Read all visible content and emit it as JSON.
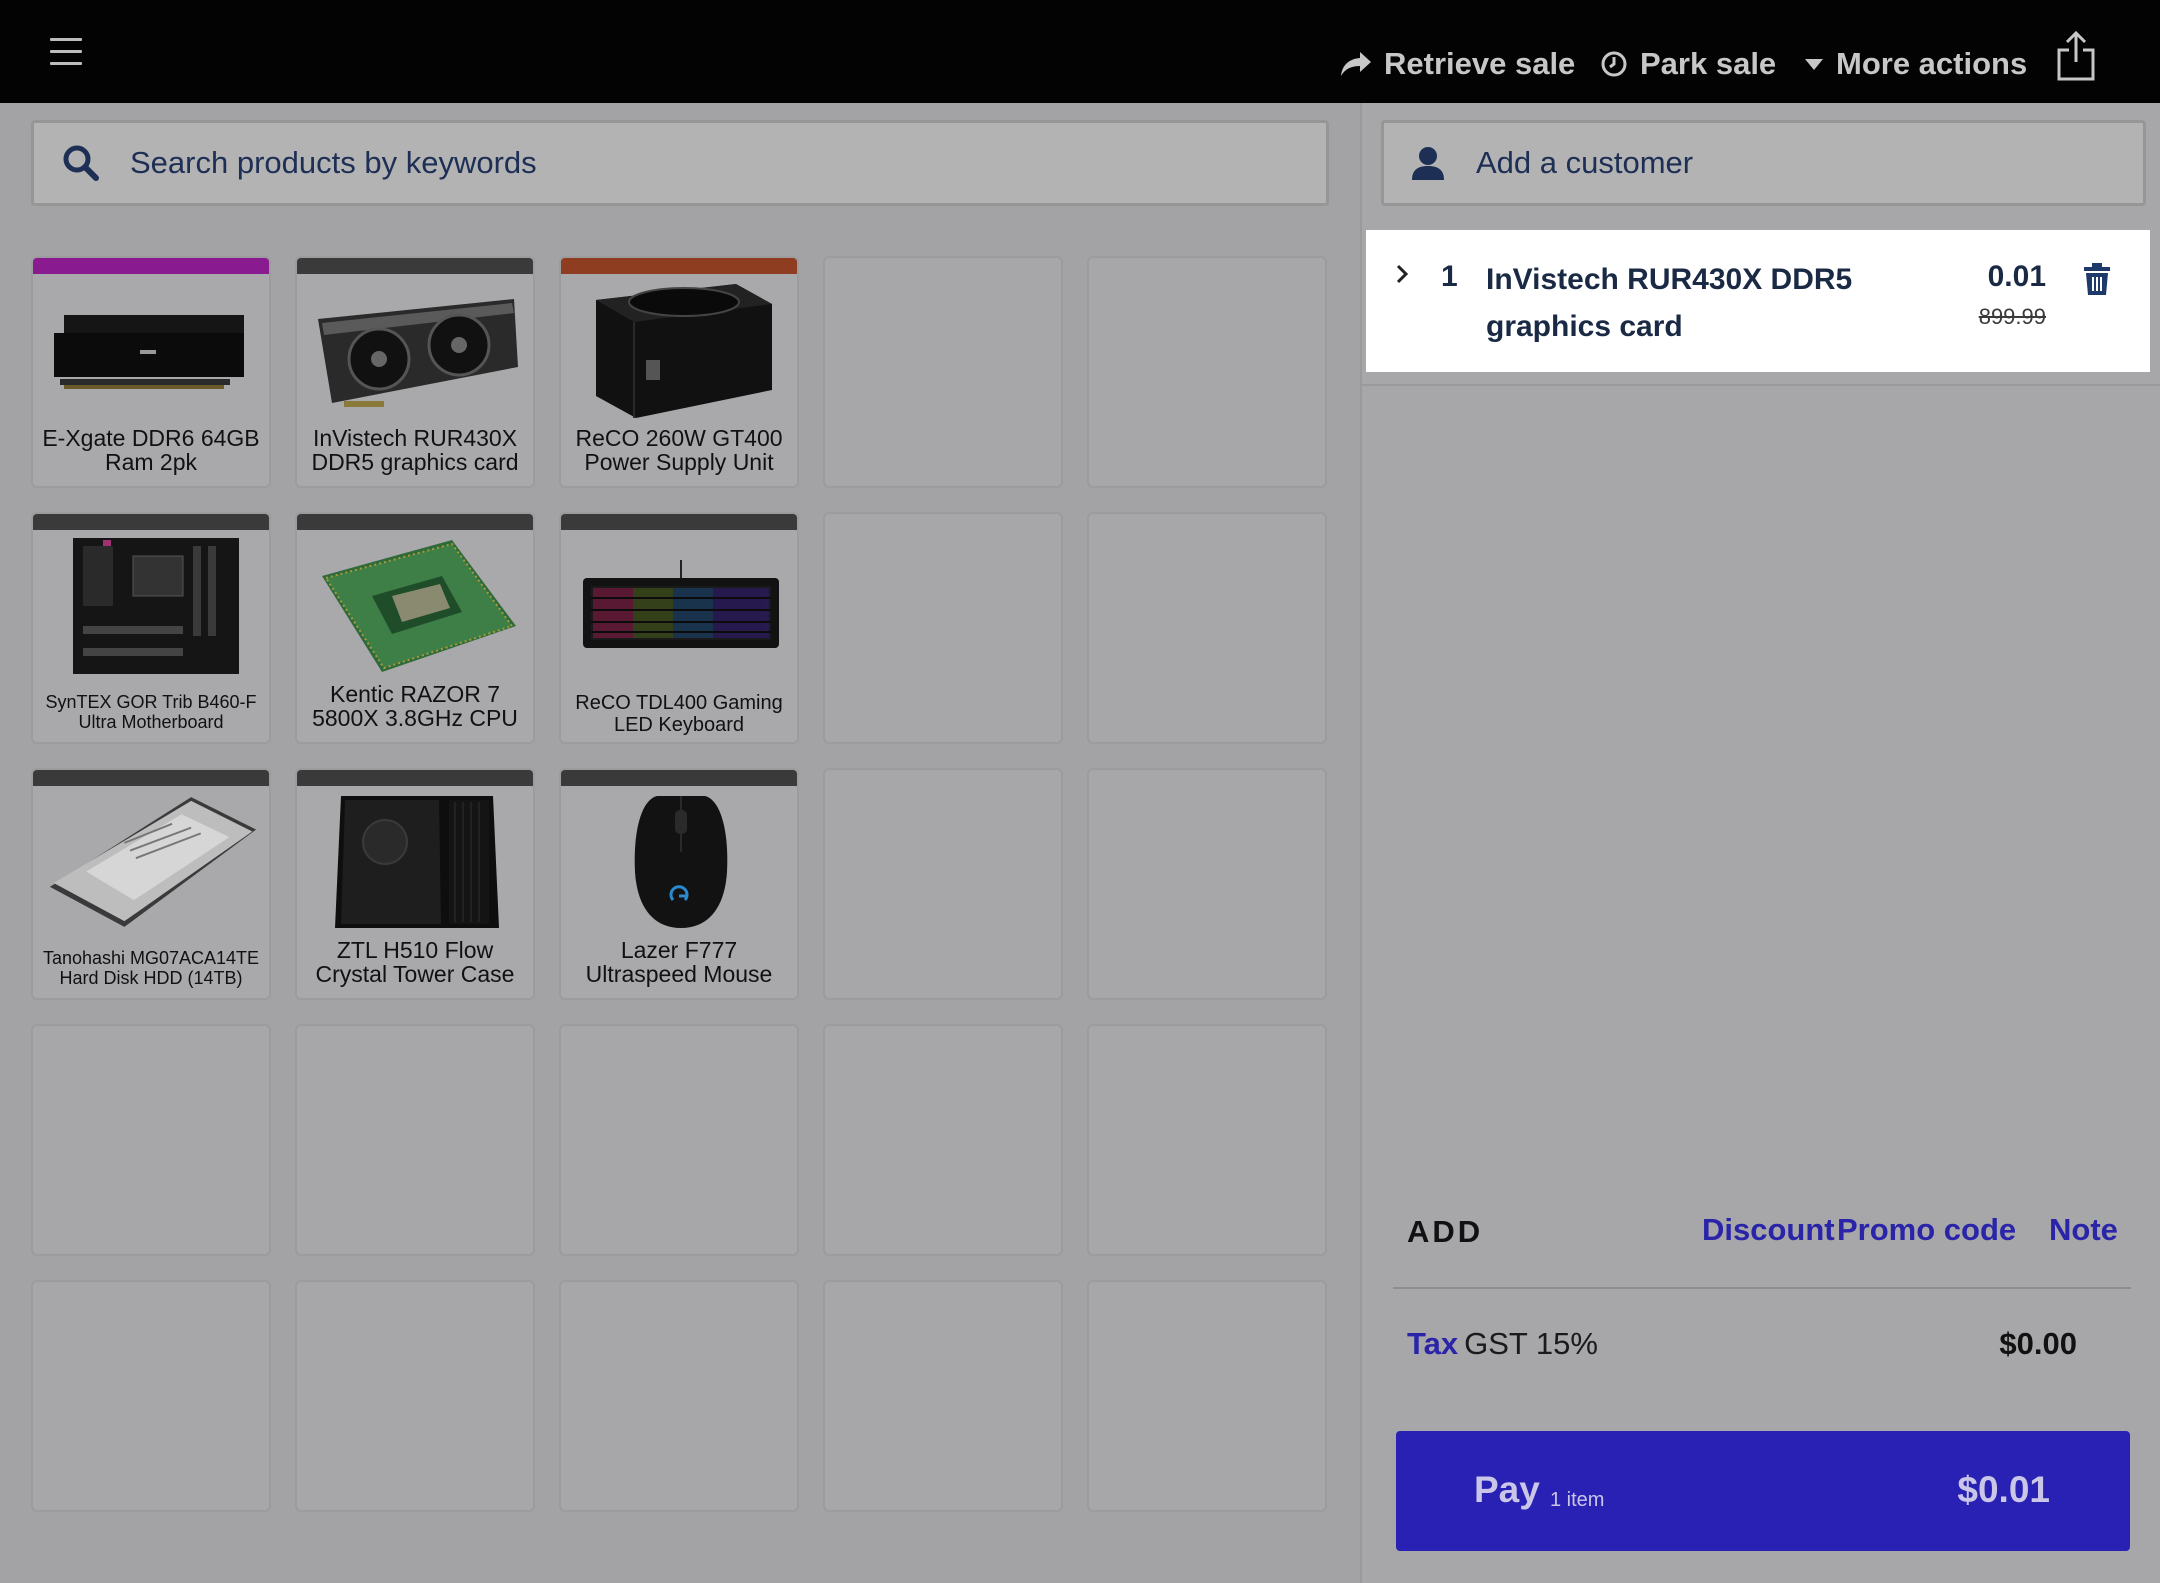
{
  "header": {
    "retrieve_label": "Retrieve sale",
    "park_label": "Park sale",
    "more_label": "More actions"
  },
  "search": {
    "placeholder": "Search products by keywords"
  },
  "products": [
    {
      "name": "E-Xgate DDR6 64GB Ram 2pk",
      "bar_color": "#8a1a90",
      "icon": "ram-icon"
    },
    {
      "name": "InVistech RUR430X DDR5 graphics card",
      "bar_color": "#3a3a3a",
      "icon": "graphics-card-icon"
    },
    {
      "name": "ReCO 260W GT400 Power Supply Unit",
      "bar_color": "#8e3d20",
      "icon": "power-supply-icon"
    },
    {
      "name": "SynTEX GOR Trib B460-F Ultra Motherboard",
      "bar_color": "#3a3a3a",
      "icon": "motherboard-icon"
    },
    {
      "name": "Kentic RAZOR 7 5800X 3.8GHz CPU",
      "bar_color": "#3a3a3a",
      "icon": "cpu-icon"
    },
    {
      "name": "ReCO TDL400 Gaming LED Keyboard",
      "bar_color": "#3a3a3a",
      "icon": "keyboard-icon"
    },
    {
      "name": "Tanohashi MG07ACA14TE Hard Disk HDD (14TB)",
      "bar_color": "#3a3a3a",
      "icon": "hard-disk-icon"
    },
    {
      "name": "ZTL H510 Flow Crystal Tower Case",
      "bar_color": "#3a3a3a",
      "icon": "tower-case-icon"
    },
    {
      "name": "Lazer F777 Ultraspeed Mouse",
      "bar_color": "#3a3a3a",
      "icon": "mouse-icon"
    }
  ],
  "customer": {
    "label": "Add a customer"
  },
  "sale": {
    "items": [
      {
        "qty": "1",
        "name": "InVistech RUR430X DDR5 graphics card",
        "price": "0.01",
        "original_price": "899.99"
      }
    ],
    "add_label": "ADD",
    "discount_label": "Discount",
    "promo_label": "Promo code",
    "note_label": "Note",
    "tax_label": "Tax",
    "tax_name": "GST 15%",
    "tax_value": "$0.00",
    "pay_label": "Pay",
    "pay_count": "1 item",
    "pay_total": "$0.01"
  },
  "colors": {
    "accent": "#2a24a8",
    "pay_button": "#2821b3",
    "topbar": "#030303"
  }
}
